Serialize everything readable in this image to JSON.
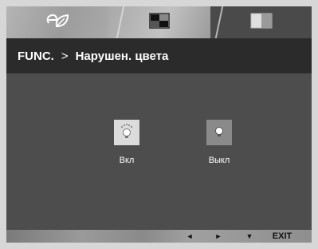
{
  "tabs": [
    {
      "icon": "eco-leaf-icon"
    },
    {
      "icon": "picture-mode-icon"
    },
    {
      "icon": "color-split-icon",
      "selected": true
    }
  ],
  "breadcrumb": {
    "root": "FUNC.",
    "separator": ">",
    "current": "Нарушен. цвета"
  },
  "options": [
    {
      "label": "Вкл",
      "icon": "bulb-on-icon",
      "selected": true
    },
    {
      "label": "Выкл",
      "icon": "bulb-off-icon",
      "selected": false
    }
  ],
  "nav": {
    "left": "◄",
    "right": "►",
    "down": "▼",
    "exit": "EXIT"
  }
}
